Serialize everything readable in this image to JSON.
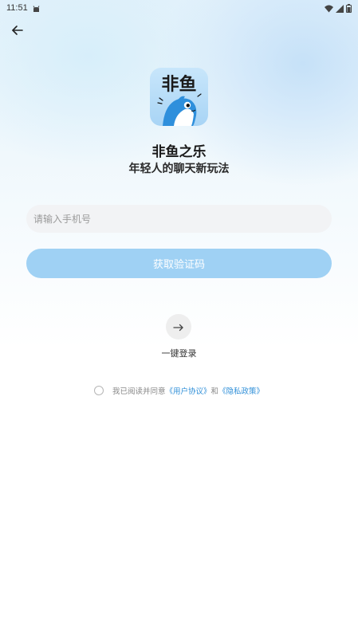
{
  "status_bar": {
    "time": "11:51"
  },
  "icons": {
    "back": "arrow-left-icon",
    "notification": "android-notification-icon",
    "wifi": "wifi-icon",
    "signal": "cellular-signal-icon",
    "battery": "battery-icon",
    "onekey": "arrow-right-icon"
  },
  "app": {
    "logo_text": "非鱼",
    "name": "非鱼之乐",
    "slogan": "年轻人的聊天新玩法"
  },
  "login": {
    "phone_placeholder": "请输入手机号",
    "phone_value": "",
    "code_button": "获取验证码",
    "onekey_label": "一键登录"
  },
  "agreement": {
    "prefix": "我已阅读并同意",
    "user_agreement": "《用户协议》",
    "conjunction": "和",
    "privacy_policy": "《隐私政策》",
    "checked": false
  },
  "colors": {
    "accent": "#2f8fd8",
    "button_disabled": "#9fd1f4",
    "input_bg": "#f2f3f5"
  }
}
